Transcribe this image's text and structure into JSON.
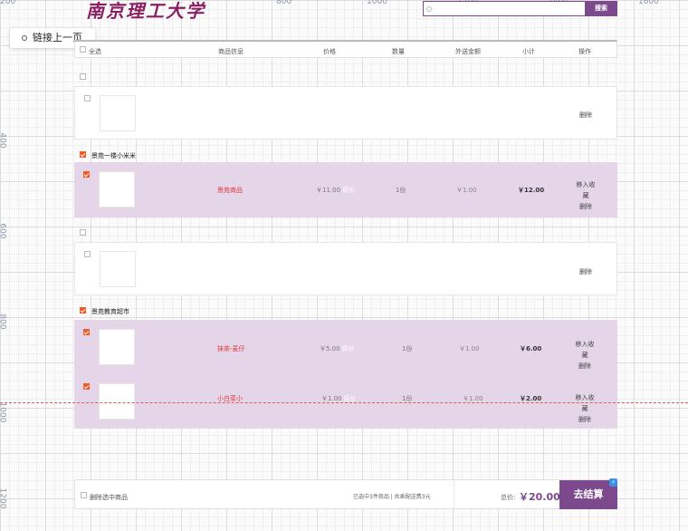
{
  "ruler": {
    "top": [
      "200",
      "800",
      "1000",
      "1200",
      "1400",
      "1600"
    ],
    "left": [
      "400",
      "600",
      "800",
      "1000",
      "1200"
    ]
  },
  "brand": {
    "logo_text": "南京理工大学"
  },
  "search": {
    "placeholder": "",
    "button": "搜索"
  },
  "prev_link": "链接上一页",
  "header": {
    "select_all": "全选",
    "product": "商品信息",
    "price": "价格",
    "qty": "数量",
    "shipping": "外送金额",
    "subtotal": "小计",
    "action": "操作"
  },
  "rows": [
    {
      "delete": "删除"
    },
    {
      "shop": "景苑一楼小米米",
      "checked": true,
      "item": {
        "name": "景苑商品",
        "price": "￥11.00",
        "orig": "原价",
        "qty": "1份",
        "fee": "￥1.00",
        "subtotal": "￥12.00",
        "fav": "移入收藏",
        "delete": "删除"
      }
    },
    {
      "delete": "删除"
    },
    {
      "shop": "景苑教育超市",
      "checked": true,
      "items": [
        {
          "name": "抹茶-麦仔",
          "price": "￥5.00",
          "orig": "原价",
          "qty": "1份",
          "fee": "￥1.00",
          "subtotal": "￥6.00",
          "fav": "移入收藏",
          "delete": "删除"
        },
        {
          "name": "小白菜小",
          "price": "￥1.00",
          "orig": "原价",
          "qty": "1份",
          "fee": "￥1.00",
          "subtotal": "￥2.00",
          "fav": "移入收藏",
          "delete": "删除"
        }
      ]
    }
  ],
  "footer": {
    "delete_selected": "删除选中商品",
    "selected_info": "已选中3件商品 | 共乘配送费3元",
    "total_label": "总价:",
    "total": "￥20.00",
    "checkout": "去结算",
    "badge": "⚡"
  },
  "colors": {
    "accent": "#7c4a8c",
    "row_bg": "#e4d5e8",
    "price_red": "#e4393c",
    "checkbox": "#f15a24"
  }
}
